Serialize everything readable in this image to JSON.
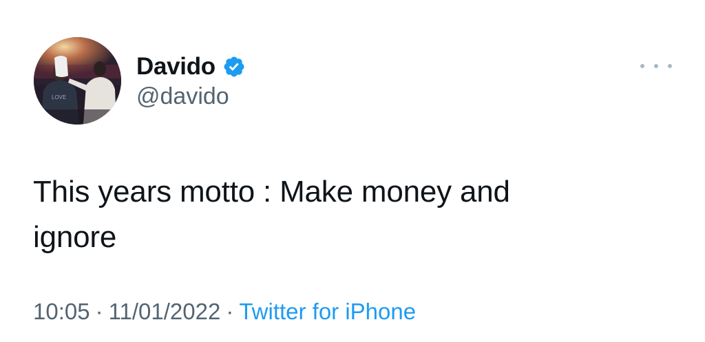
{
  "user": {
    "display_name": "Davido",
    "handle": "@davido",
    "verified": true,
    "avatar_icon": "profile-photo"
  },
  "tweet": {
    "text_line1": "This years motto : Make money and",
    "text_line2": "ignore"
  },
  "meta": {
    "time": "10:05",
    "date": "11/01/2022",
    "separator": "·",
    "source": "Twitter for iPhone"
  },
  "colors": {
    "text": "#0f1419",
    "secondary": "#536471",
    "link": "#1d9bf0",
    "verified_badge": "#1d9bf0"
  },
  "icons": {
    "verified": "verified-badge-icon",
    "more": "more-options-icon"
  }
}
